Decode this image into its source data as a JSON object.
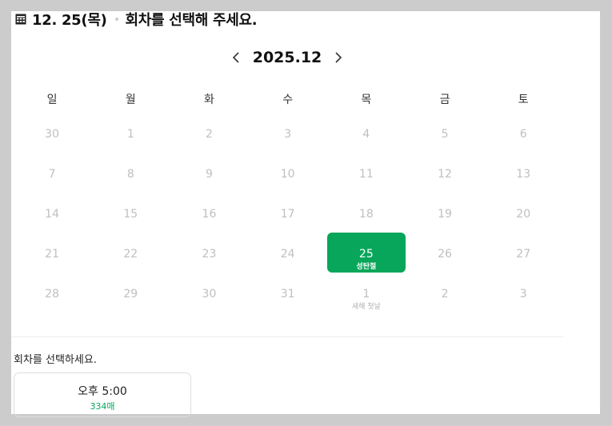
{
  "header": {
    "date": "12. 25(목)",
    "instruction": "회차를 선택해 주세요.",
    "icon": "calendar-icon"
  },
  "calendar": {
    "month_label": "2025.12",
    "prev_icon": "chevron-left-icon",
    "next_icon": "chevron-right-icon",
    "weekdays": [
      "일",
      "월",
      "화",
      "수",
      "목",
      "금",
      "토"
    ],
    "weeks": [
      [
        {
          "day": "30"
        },
        {
          "day": "1"
        },
        {
          "day": "2"
        },
        {
          "day": "3"
        },
        {
          "day": "4"
        },
        {
          "day": "5"
        },
        {
          "day": "6"
        }
      ],
      [
        {
          "day": "7"
        },
        {
          "day": "8"
        },
        {
          "day": "9"
        },
        {
          "day": "10"
        },
        {
          "day": "11"
        },
        {
          "day": "12"
        },
        {
          "day": "13"
        }
      ],
      [
        {
          "day": "14"
        },
        {
          "day": "15"
        },
        {
          "day": "16"
        },
        {
          "day": "17"
        },
        {
          "day": "18"
        },
        {
          "day": "19"
        },
        {
          "day": "20"
        }
      ],
      [
        {
          "day": "21"
        },
        {
          "day": "22"
        },
        {
          "day": "23"
        },
        {
          "day": "24"
        },
        {
          "day": "25",
          "holiday": "성탄절",
          "selected": true
        },
        {
          "day": "26"
        },
        {
          "day": "27"
        }
      ],
      [
        {
          "day": "28"
        },
        {
          "day": "29"
        },
        {
          "day": "30"
        },
        {
          "day": "31"
        },
        {
          "day": "1",
          "holiday": "새해 첫날"
        },
        {
          "day": "2"
        },
        {
          "day": "3"
        }
      ]
    ],
    "selected_color": "#08a65a"
  },
  "session": {
    "prompt": "회차를 선택하세요.",
    "options": [
      {
        "time": "오후 5:00",
        "seats": "334매"
      }
    ]
  }
}
